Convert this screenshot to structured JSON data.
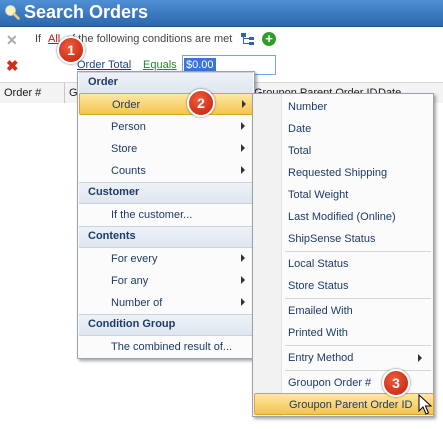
{
  "window": {
    "title": "Search Orders"
  },
  "filter": {
    "prefix": "If",
    "quantifier": "All",
    "suffix": "of the following conditions are met",
    "condition": {
      "field": "Order Total",
      "operator": "Equals",
      "value": "$0.00"
    }
  },
  "grid": {
    "columns": [
      "Order #",
      "G",
      "Groupon Parent Order ID",
      "Date"
    ]
  },
  "menu": {
    "sections": [
      {
        "header": "Order",
        "items": [
          {
            "label": "Order",
            "submenu": true,
            "highlighted": true
          },
          {
            "label": "Person",
            "submenu": true
          },
          {
            "label": "Store",
            "submenu": true
          },
          {
            "label": "Counts",
            "submenu": true
          }
        ]
      },
      {
        "header": "Customer",
        "items": [
          {
            "label": "If the customer...",
            "submenu": false
          }
        ]
      },
      {
        "header": "Contents",
        "items": [
          {
            "label": "For every",
            "submenu": true
          },
          {
            "label": "For any",
            "submenu": true
          },
          {
            "label": "Number of",
            "submenu": true
          }
        ]
      },
      {
        "header": "Condition Group",
        "items": [
          {
            "label": "The combined result of...",
            "submenu": false
          }
        ]
      }
    ]
  },
  "submenu": {
    "groups": [
      [
        "Number",
        "Date",
        "Total",
        "Requested Shipping",
        "Total Weight",
        "Last Modified (Online)",
        "ShipSense Status"
      ],
      [
        "Local Status",
        "Store Status"
      ],
      [
        "Emailed With",
        "Printed With"
      ],
      [
        "Entry Method"
      ],
      [
        "Groupon Order #",
        "Groupon Parent Order ID"
      ]
    ],
    "highlighted": "Groupon Parent Order ID",
    "with_arrow": [
      "Entry Method"
    ]
  },
  "badges": [
    "1",
    "2",
    "3"
  ],
  "colors": {
    "title_bar": "#2b67ad",
    "highlight": "#f6c34f",
    "badge": "#d42a18"
  }
}
